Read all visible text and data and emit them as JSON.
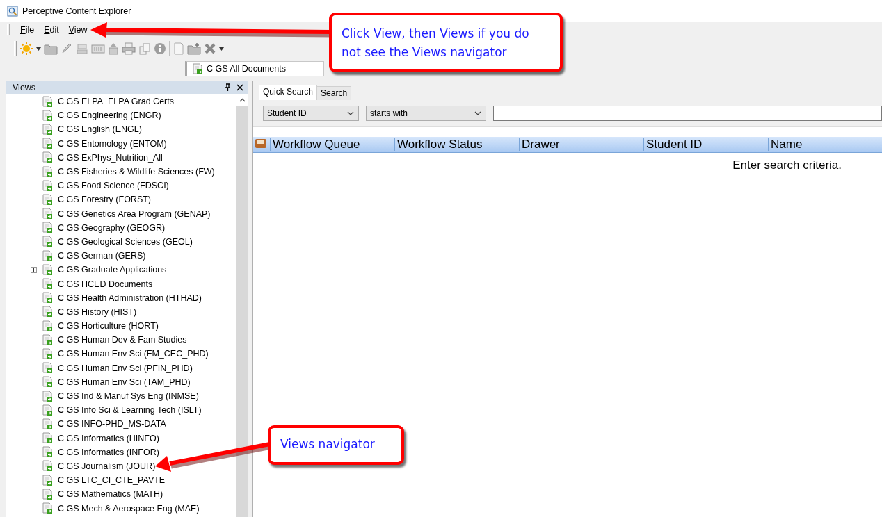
{
  "window": {
    "title": "Perceptive Content Explorer"
  },
  "menu": [
    {
      "label": "File"
    },
    {
      "label": "Edit"
    },
    {
      "label": "View"
    }
  ],
  "view_selector": {
    "value": "C GS All Documents"
  },
  "views_panel": {
    "title": "Views",
    "items": [
      {
        "label": "C GS ELPA_ELPA Grad Certs",
        "expandable": false
      },
      {
        "label": "C GS Engineering (ENGR)",
        "expandable": false
      },
      {
        "label": "C GS English (ENGL)",
        "expandable": false
      },
      {
        "label": "C GS Entomology (ENTOM)",
        "expandable": false
      },
      {
        "label": "C GS ExPhys_Nutrition_All",
        "expandable": false
      },
      {
        "label": "C GS Fisheries & Wildlife Sciences (FW)",
        "expandable": false
      },
      {
        "label": "C GS Food Science (FDSCI)",
        "expandable": false
      },
      {
        "label": "C GS Forestry (FORST)",
        "expandable": false
      },
      {
        "label": "C GS Genetics Area Program (GENAP)",
        "expandable": false
      },
      {
        "label": "C GS Geography (GEOGR)",
        "expandable": false
      },
      {
        "label": "C GS Geological Sciences (GEOL)",
        "expandable": false
      },
      {
        "label": "C GS German (GERS)",
        "expandable": false
      },
      {
        "label": "C GS Graduate Applications",
        "expandable": true
      },
      {
        "label": "C GS HCED Documents",
        "expandable": false
      },
      {
        "label": "C GS Health Administration (HTHAD)",
        "expandable": false
      },
      {
        "label": "C GS History (HIST)",
        "expandable": false
      },
      {
        "label": "C GS Horticulture (HORT)",
        "expandable": false
      },
      {
        "label": "C GS Human Dev & Fam Studies",
        "expandable": false
      },
      {
        "label": "C GS Human Env Sci (FM_CEC_PHD)",
        "expandable": false
      },
      {
        "label": "C GS Human Env Sci (PFIN_PHD)",
        "expandable": false
      },
      {
        "label": "C GS Human Env Sci (TAM_PHD)",
        "expandable": false
      },
      {
        "label": "C GS Ind & Manuf Sys Eng (INMSE)",
        "expandable": false
      },
      {
        "label": "C GS Info Sci & Learning Tech (ISLT)",
        "expandable": false
      },
      {
        "label": "C GS INFO-PHD_MS-DATA",
        "expandable": false
      },
      {
        "label": "C GS Informatics (HINFO)",
        "expandable": false
      },
      {
        "label": "C GS Informatics (INFOR)",
        "expandable": false
      },
      {
        "label": "C GS Journalism (JOUR)",
        "expandable": false
      },
      {
        "label": "C GS LTC_CI_CTE_PAVTE",
        "expandable": false
      },
      {
        "label": "C GS Mathematics (MATH)",
        "expandable": false
      },
      {
        "label": "C GS Mech & Aerospace Eng (MAE)",
        "expandable": false
      }
    ]
  },
  "search": {
    "tabs": [
      {
        "label": "Quick Search",
        "selected": true
      },
      {
        "label": "Search",
        "selected": false
      }
    ],
    "field": {
      "value": "Student ID"
    },
    "operator": {
      "value": "starts with"
    },
    "columns": [
      "Workflow Queue",
      "Workflow Status",
      "Drawer",
      "Student ID",
      "Name"
    ],
    "empty_message": "Enter search criteria."
  },
  "callouts": [
    {
      "text": "Click View, then Views if you do not see the Views navigator"
    },
    {
      "text": "Views navigator"
    }
  ]
}
